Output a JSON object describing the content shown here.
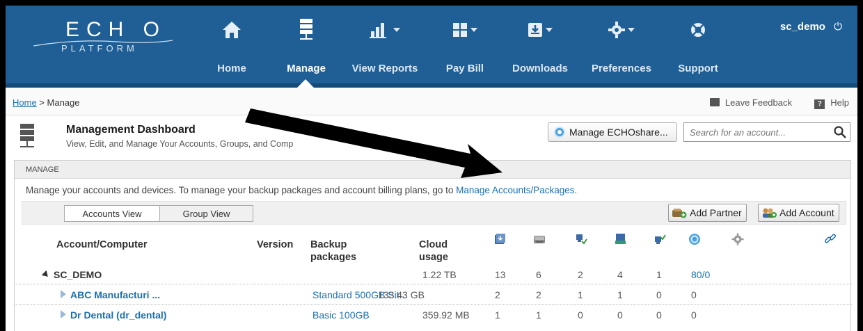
{
  "header": {
    "logo_top": "ECH O",
    "logo_bottom": "PLATFORM",
    "user": "sc_demo",
    "nav": [
      {
        "label": "Home",
        "icon": "home-icon"
      },
      {
        "label": "Manage",
        "icon": "server-icon",
        "active": true
      },
      {
        "label": "View Reports",
        "icon": "bar-chart-icon"
      },
      {
        "label": "Pay Bill",
        "icon": "grid-icon"
      },
      {
        "label": "Downloads",
        "icon": "download-icon"
      },
      {
        "label": "Preferences",
        "icon": "gear-icon"
      },
      {
        "label": "Support",
        "icon": "lifebuoy-icon"
      }
    ]
  },
  "breadcrumb": {
    "home": "Home",
    "separator": " > ",
    "current": "Manage",
    "feedback": "Leave Feedback",
    "help": "Help"
  },
  "dashboard": {
    "title": "Management Dashboard",
    "subtitle": "View, Edit, and Manage Your Accounts, Groups, and Comp",
    "echoshare_button": "Manage ECHOshare...",
    "search_placeholder": "Search for an account..."
  },
  "panel": {
    "heading": "MANAGE",
    "info_text": "Manage your accounts and devices. To manage your backup packages and account billing plans, go to ",
    "info_link": "Manage Accounts/Packages.",
    "tab_accounts": "Accounts View",
    "tab_groups": "Group View",
    "add_partner": "Add Partner",
    "add_account": "Add Account"
  },
  "table": {
    "headers": {
      "account": "Account/Computer",
      "version": "Version",
      "backup": "Backup packages",
      "cloud": "Cloud usage"
    },
    "header_icons": [
      "backup-sets-icon",
      "drive-icon",
      "computer-online-icon",
      "computer-disk-icon",
      "computer-offline-icon",
      "echoshare-icon",
      "settings-icon",
      "link-icon"
    ],
    "rows": [
      {
        "name": "SC_DEMO",
        "package": "",
        "cloud": "1.22 TB",
        "v1": "13",
        "v2": "6",
        "v3": "2",
        "v4": "4",
        "v5": "1",
        "v6": "80/0"
      },
      {
        "name": "ABC Manufacturi ...",
        "package": "Standard 500GB Sit...",
        "cloud": "133.43 GB",
        "v1": "2",
        "v2": "2",
        "v3": "1",
        "v4": "1",
        "v5": "0",
        "v6": "0"
      },
      {
        "name": "Dr Dental (dr_dental)",
        "package": "Basic 100GB",
        "cloud": "359.92 MB",
        "v1": "1",
        "v2": "1",
        "v3": "0",
        "v4": "0",
        "v5": "0",
        "v6": "0"
      }
    ]
  }
}
